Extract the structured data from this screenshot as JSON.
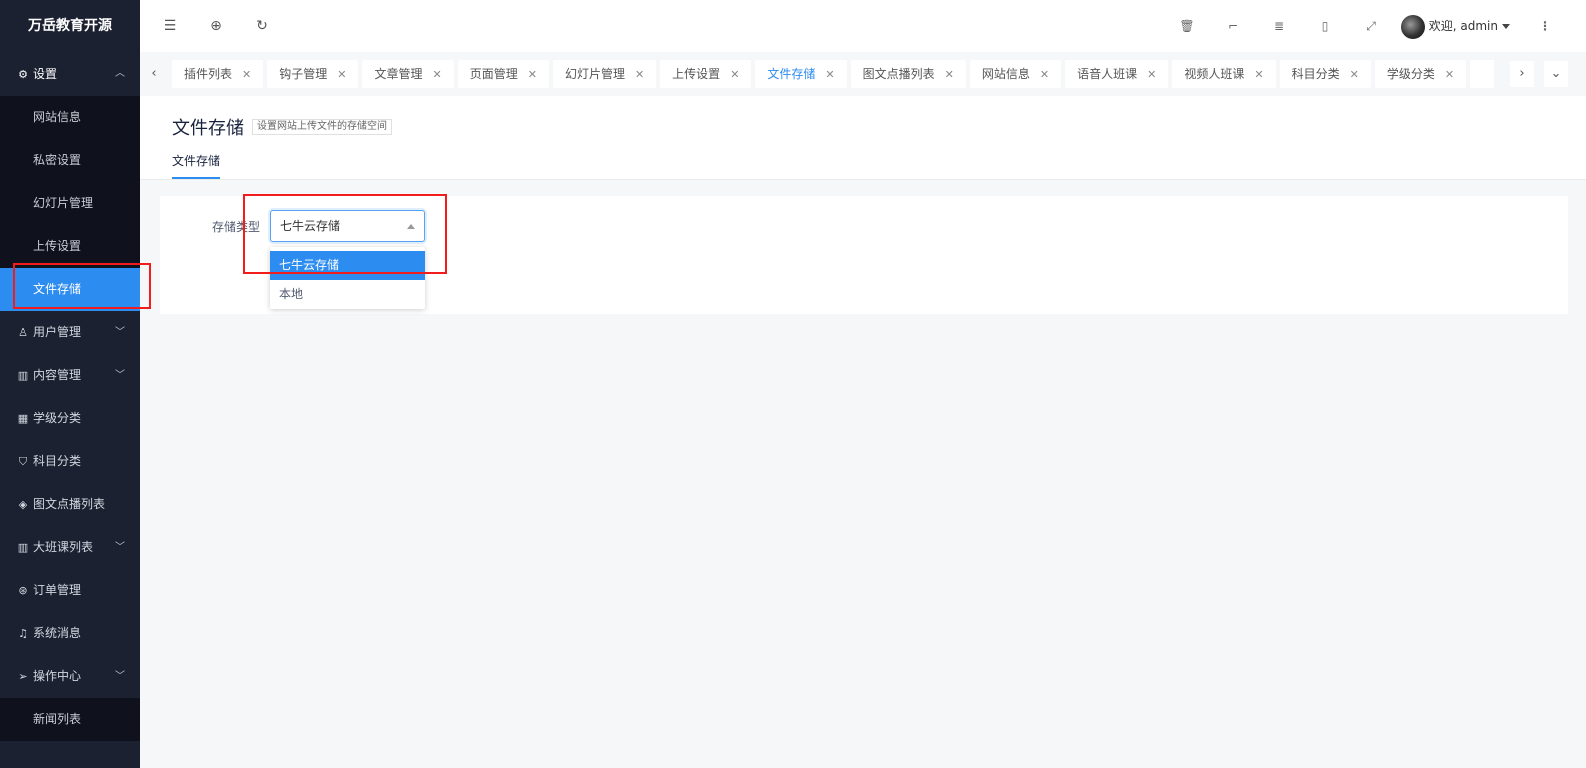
{
  "app": {
    "logo": "万岳教育开源"
  },
  "sidebar": {
    "settings": {
      "label": "设置",
      "icon": "gear-icon"
    },
    "sub_items": [
      "网站信息",
      "私密设置",
      "幻灯片管理",
      "上传设置",
      "文件存储"
    ],
    "active_sub": "文件存储",
    "items": [
      {
        "label": "用户管理",
        "icon": "user-icon",
        "expandable": true
      },
      {
        "label": "内容管理",
        "icon": "book-icon",
        "expandable": true
      },
      {
        "label": "学级分类",
        "icon": "grid-icon",
        "expandable": false
      },
      {
        "label": "科目分类",
        "icon": "shield-icon",
        "expandable": false
      },
      {
        "label": "图文点播列表",
        "icon": "image-icon",
        "expandable": false
      },
      {
        "label": "大班课列表",
        "icon": "book-icon",
        "expandable": true
      },
      {
        "label": "订单管理",
        "icon": "order-icon",
        "expandable": false
      },
      {
        "label": "系统消息",
        "icon": "bell-icon",
        "expandable": false
      },
      {
        "label": "操作中心",
        "icon": "send-icon",
        "expandable": true
      }
    ],
    "last_item": "新闻列表"
  },
  "header": {
    "user_greeting": "欢迎, admin",
    "accent": "#2d8cf0"
  },
  "tabs": [
    {
      "label": "插件列表"
    },
    {
      "label": "钩子管理"
    },
    {
      "label": "文章管理"
    },
    {
      "label": "页面管理"
    },
    {
      "label": "幻灯片管理"
    },
    {
      "label": "上传设置"
    },
    {
      "label": "文件存储",
      "active": true
    },
    {
      "label": "图文点播列表"
    },
    {
      "label": "网站信息"
    },
    {
      "label": "语音人班课"
    },
    {
      "label": "视频人班课"
    },
    {
      "label": "科目分类"
    },
    {
      "label": "学级分类"
    }
  ],
  "page": {
    "title": "文件存储",
    "description": "设置网站上传文件的存储空间",
    "tab": "文件存储"
  },
  "form": {
    "label": "存储类型",
    "value": "七牛云存储",
    "options": [
      "七牛云存储",
      "本地"
    ],
    "selected_option": "七牛云存储"
  }
}
